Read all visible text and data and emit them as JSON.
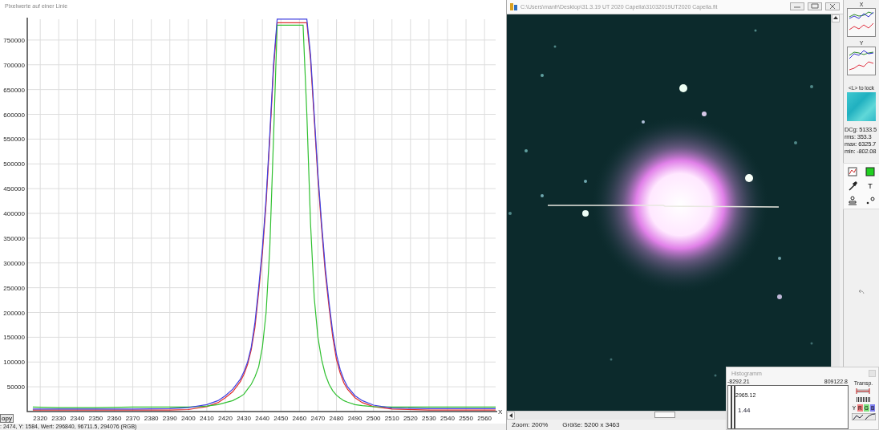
{
  "profile_window": {
    "title": "Pixelwerte auf einer Linie",
    "copy_button": "opy",
    "status": ": 2474, Y: 1584, Wert: 296840, 96711.5, 294076 (RGB)",
    "chart_data": {
      "type": "line",
      "xlabel": "X",
      "grid": true,
      "xlim": [
        2313,
        2566
      ],
      "ylim": [
        0,
        800000
      ],
      "xticks": [
        2320,
        2330,
        2340,
        2350,
        2360,
        2370,
        2380,
        2390,
        2400,
        2410,
        2420,
        2430,
        2440,
        2450,
        2460,
        2470,
        2480,
        2490,
        2500,
        2510,
        2520,
        2530,
        2540,
        2550,
        2560
      ],
      "yticks": [
        50000,
        100000,
        150000,
        200000,
        250000,
        300000,
        350000,
        400000,
        450000,
        500000,
        550000,
        600000,
        650000,
        700000,
        750000
      ],
      "x": [
        2316,
        2330,
        2350,
        2370,
        2390,
        2400,
        2410,
        2416,
        2420,
        2424,
        2428,
        2430,
        2432,
        2434,
        2436,
        2438,
        2440,
        2442,
        2444,
        2446,
        2448,
        2450,
        2455,
        2460,
        2462,
        2464,
        2466,
        2468,
        2470,
        2472,
        2474,
        2476,
        2478,
        2480,
        2482,
        2484,
        2486,
        2490,
        2494,
        2500,
        2510,
        2530,
        2550,
        2566
      ],
      "series": [
        {
          "color": "#e03030",
          "values": [
            3000,
            3000,
            3000,
            3000,
            3000,
            4000,
            10000,
            18000,
            28000,
            40000,
            60000,
            75000,
            95000,
            125000,
            170000,
            240000,
            320000,
            420000,
            550000,
            690000,
            785000,
            785000,
            785000,
            785000,
            785000,
            785000,
            710000,
            590000,
            470000,
            370000,
            280000,
            210000,
            150000,
            105000,
            78000,
            58000,
            45000,
            28000,
            18000,
            10000,
            5000,
            3000,
            3000,
            3000
          ]
        },
        {
          "color": "#30c030",
          "values": [
            9000,
            8000,
            8000,
            9000,
            9000,
            9000,
            11000,
            14000,
            18000,
            22000,
            30000,
            35000,
            45000,
            55000,
            70000,
            90000,
            130000,
            200000,
            330000,
            550000,
            780000,
            780000,
            780000,
            780000,
            780000,
            600000,
            380000,
            230000,
            150000,
            105000,
            75000,
            55000,
            42000,
            33000,
            27000,
            22000,
            19000,
            14000,
            12000,
            10000,
            9000,
            9000,
            9000,
            9000
          ]
        },
        {
          "color": "#4040e0",
          "values": [
            5000,
            5000,
            5000,
            5000,
            6000,
            8000,
            14000,
            22000,
            32000,
            45000,
            65000,
            80000,
            100000,
            130000,
            180000,
            250000,
            330000,
            430000,
            560000,
            700000,
            792000,
            792000,
            792000,
            792000,
            792000,
            792000,
            720000,
            600000,
            480000,
            380000,
            290000,
            220000,
            160000,
            115000,
            85000,
            65000,
            50000,
            32000,
            22000,
            13000,
            7000,
            6000,
            6000,
            6000
          ]
        }
      ]
    }
  },
  "image_window": {
    "title": "C:\\Users\\manfr\\Desktop\\31.3.19 UT 2020 Capella\\31032019UT2020 Capella.fit",
    "zoom": "Zoom: 200%",
    "size": "Größe: 5200 x 3463"
  },
  "tool_panel": {
    "x_label": "X",
    "y_label": "Y",
    "lock_hint": "<L> to lock",
    "stats": [
      "DCg: 5133.5",
      "rms: 353.3",
      "max: 6325.7",
      "min: -802.08"
    ],
    "text_tool": "T"
  },
  "histogram": {
    "title": "Histogramm",
    "min": "-8292.21",
    "max": "809122.8",
    "marker": "2965.12",
    "side_value": "1.44",
    "transp": "Transp.",
    "channels": [
      {
        "label": "Y",
        "color": "#f0f0f0"
      },
      {
        "label": "R",
        "color": "#f08080"
      },
      {
        "label": "G",
        "color": "#80e080"
      },
      {
        "label": "B",
        "color": "#8080f0"
      }
    ]
  }
}
